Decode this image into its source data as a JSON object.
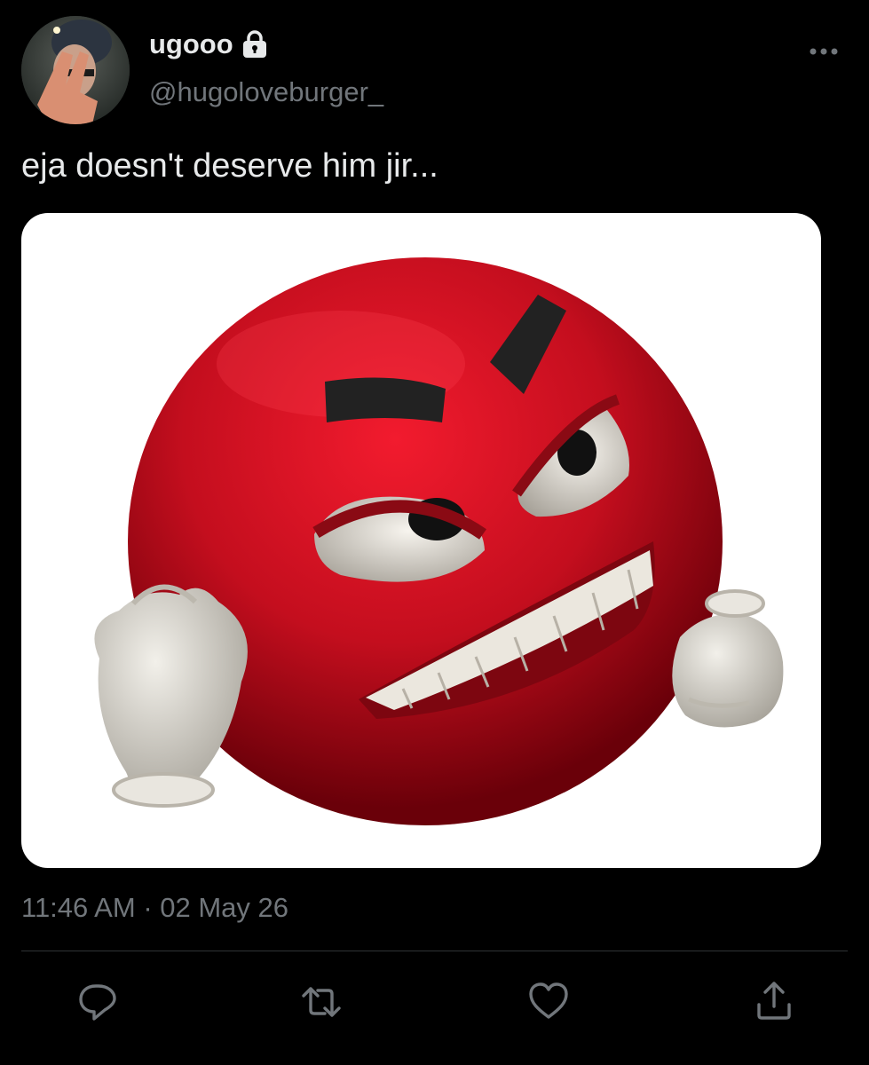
{
  "tweet": {
    "author": {
      "display_name": "ugooo",
      "handle": "@hugoloveburger_",
      "protected_icon": "lock-icon",
      "avatar": "avatar"
    },
    "text": "eja doesn't deserve him jir...",
    "media": {
      "description_icon": "angry-red-emoji-image"
    },
    "time": "11:46 AM",
    "separator": "·",
    "date": "02 May 26"
  },
  "actions": {
    "reply_icon": "reply-icon",
    "retweet_icon": "retweet-icon",
    "like_icon": "heart-icon",
    "share_icon": "share-icon",
    "more_icon": "more-icon"
  },
  "colors": {
    "background": "#000000",
    "primary_text": "#e7e9ea",
    "secondary_text": "#71767b",
    "divider": "#2f3336"
  }
}
